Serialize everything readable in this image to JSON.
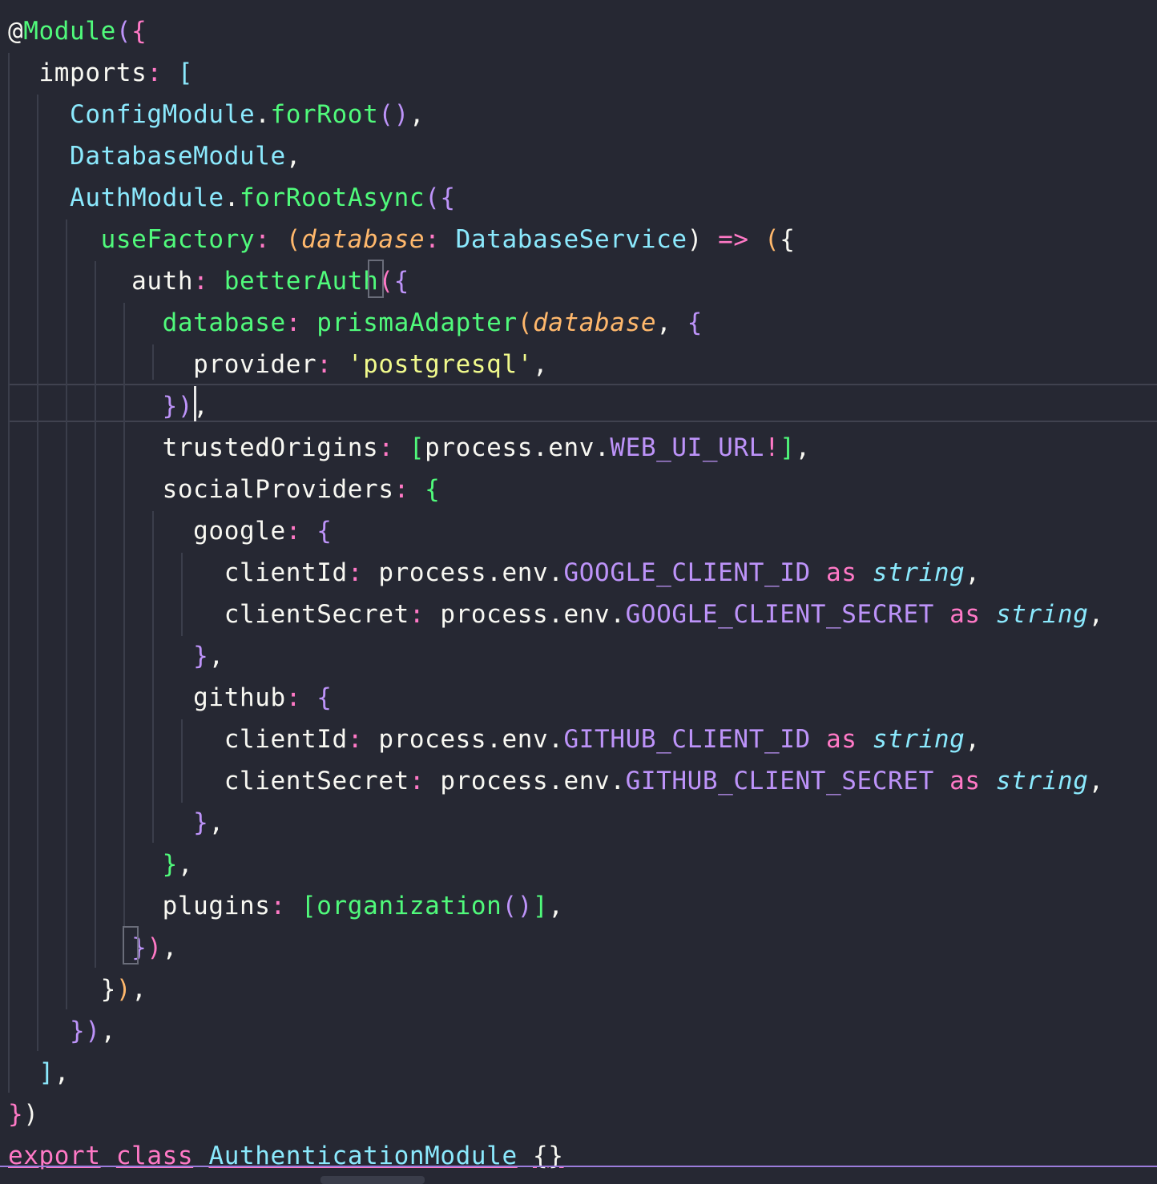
{
  "editor": {
    "language": "typescript",
    "cursor_line": 10,
    "lines": [
      [
        [
          "@",
          "white"
        ],
        [
          "Module",
          "green"
        ],
        [
          "(",
          "purple"
        ],
        [
          "{",
          "pink"
        ]
      ],
      [
        [
          "  imports",
          "white"
        ],
        [
          ":",
          "pink"
        ],
        [
          " ",
          "white"
        ],
        [
          "[",
          "cyan"
        ]
      ],
      [
        [
          "    ConfigModule",
          "cyan"
        ],
        [
          ".",
          "white"
        ],
        [
          "forRoot",
          "green"
        ],
        [
          "()",
          "purple"
        ],
        [
          ",",
          "white"
        ]
      ],
      [
        [
          "    DatabaseModule",
          "cyan"
        ],
        [
          ",",
          "white"
        ]
      ],
      [
        [
          "    AuthModule",
          "cyan"
        ],
        [
          ".",
          "white"
        ],
        [
          "forRootAsync",
          "green"
        ],
        [
          "(",
          "purple"
        ],
        [
          "{",
          "purple"
        ]
      ],
      [
        [
          "      useFactory",
          "green"
        ],
        [
          ":",
          "pink"
        ],
        [
          " ",
          "white"
        ],
        [
          "(",
          "orange"
        ],
        [
          "database",
          "orange-it"
        ],
        [
          ":",
          "pink"
        ],
        [
          " ",
          "white"
        ],
        [
          "DatabaseService",
          "cyan"
        ],
        [
          ")",
          "white"
        ],
        [
          " ",
          "white"
        ],
        [
          "=>",
          "pink"
        ],
        [
          " ",
          "white"
        ],
        [
          "(",
          "orange"
        ],
        [
          "{",
          "white"
        ]
      ],
      [
        [
          "        auth",
          "white"
        ],
        [
          ":",
          "pink"
        ],
        [
          " ",
          "white"
        ],
        [
          "betterAuth",
          "green"
        ],
        [
          "(",
          "pink"
        ],
        [
          "{",
          "purple"
        ]
      ],
      [
        [
          "          database",
          "green"
        ],
        [
          ":",
          "pink"
        ],
        [
          " ",
          "white"
        ],
        [
          "prismaAdapter",
          "green"
        ],
        [
          "(",
          "orange"
        ],
        [
          "database",
          "orange-it"
        ],
        [
          ",",
          "white"
        ],
        [
          " ",
          "white"
        ],
        [
          "{",
          "purple"
        ]
      ],
      [
        [
          "            provider",
          "white"
        ],
        [
          ":",
          "pink"
        ],
        [
          " ",
          "white"
        ],
        [
          "'postgresql'",
          "yellow"
        ],
        [
          ",",
          "white"
        ]
      ],
      [
        [
          "          }",
          "purple"
        ],
        [
          ")",
          "purple"
        ],
        [
          ",",
          "white"
        ]
      ],
      [
        [
          "          trustedOrigins",
          "white"
        ],
        [
          ":",
          "pink"
        ],
        [
          " ",
          "white"
        ],
        [
          "[",
          "green"
        ],
        [
          "process",
          "white"
        ],
        [
          ".",
          "white"
        ],
        [
          "env",
          "white"
        ],
        [
          ".",
          "white"
        ],
        [
          "WEB_UI_URL",
          "purple"
        ],
        [
          "!",
          "pink"
        ],
        [
          "]",
          "green"
        ],
        [
          ",",
          "white"
        ]
      ],
      [
        [
          "          socialProviders",
          "white"
        ],
        [
          ":",
          "pink"
        ],
        [
          " ",
          "white"
        ],
        [
          "{",
          "green"
        ]
      ],
      [
        [
          "            google",
          "white"
        ],
        [
          ":",
          "pink"
        ],
        [
          " ",
          "white"
        ],
        [
          "{",
          "purple"
        ]
      ],
      [
        [
          "              clientId",
          "white"
        ],
        [
          ":",
          "pink"
        ],
        [
          " ",
          "white"
        ],
        [
          "process",
          "white"
        ],
        [
          ".",
          "white"
        ],
        [
          "env",
          "white"
        ],
        [
          ".",
          "white"
        ],
        [
          "GOOGLE_CLIENT_ID",
          "purple"
        ],
        [
          " ",
          "white"
        ],
        [
          "as",
          "pink"
        ],
        [
          " ",
          "white"
        ],
        [
          "string",
          "cyan-it"
        ],
        [
          ",",
          "white"
        ]
      ],
      [
        [
          "              clientSecret",
          "white"
        ],
        [
          ":",
          "pink"
        ],
        [
          " ",
          "white"
        ],
        [
          "process",
          "white"
        ],
        [
          ".",
          "white"
        ],
        [
          "env",
          "white"
        ],
        [
          ".",
          "white"
        ],
        [
          "GOOGLE_CLIENT_SECRET",
          "purple"
        ],
        [
          " ",
          "white"
        ],
        [
          "as",
          "pink"
        ],
        [
          " ",
          "white"
        ],
        [
          "string",
          "cyan-it"
        ],
        [
          ",",
          "white"
        ]
      ],
      [
        [
          "            }",
          "purple"
        ],
        [
          ",",
          "white"
        ]
      ],
      [
        [
          "            github",
          "white"
        ],
        [
          ":",
          "pink"
        ],
        [
          " ",
          "white"
        ],
        [
          "{",
          "purple"
        ]
      ],
      [
        [
          "              clientId",
          "white"
        ],
        [
          ":",
          "pink"
        ],
        [
          " ",
          "white"
        ],
        [
          "process",
          "white"
        ],
        [
          ".",
          "white"
        ],
        [
          "env",
          "white"
        ],
        [
          ".",
          "white"
        ],
        [
          "GITHUB_CLIENT_ID",
          "purple"
        ],
        [
          " ",
          "white"
        ],
        [
          "as",
          "pink"
        ],
        [
          " ",
          "white"
        ],
        [
          "string",
          "cyan-it"
        ],
        [
          ",",
          "white"
        ]
      ],
      [
        [
          "              clientSecret",
          "white"
        ],
        [
          ":",
          "pink"
        ],
        [
          " ",
          "white"
        ],
        [
          "process",
          "white"
        ],
        [
          ".",
          "white"
        ],
        [
          "env",
          "white"
        ],
        [
          ".",
          "white"
        ],
        [
          "GITHUB_CLIENT_SECRET",
          "purple"
        ],
        [
          " ",
          "white"
        ],
        [
          "as",
          "pink"
        ],
        [
          " ",
          "white"
        ],
        [
          "string",
          "cyan-it"
        ],
        [
          ",",
          "white"
        ]
      ],
      [
        [
          "            }",
          "purple"
        ],
        [
          ",",
          "white"
        ]
      ],
      [
        [
          "          }",
          "green"
        ],
        [
          ",",
          "white"
        ]
      ],
      [
        [
          "          plugins",
          "white"
        ],
        [
          ":",
          "pink"
        ],
        [
          " ",
          "white"
        ],
        [
          "[",
          "green"
        ],
        [
          "organization",
          "green"
        ],
        [
          "()",
          "purple"
        ],
        [
          "]",
          "green"
        ],
        [
          ",",
          "white"
        ]
      ],
      [
        [
          "        }",
          "purple"
        ],
        [
          ")",
          "pink"
        ],
        [
          ",",
          "white"
        ]
      ],
      [
        [
          "      }",
          "white"
        ],
        [
          ")",
          "orange"
        ],
        [
          ",",
          "white"
        ]
      ],
      [
        [
          "    }",
          "purple"
        ],
        [
          ")",
          "purple"
        ],
        [
          ",",
          "white"
        ]
      ],
      [
        [
          "  ]",
          "cyan"
        ],
        [
          ",",
          "white"
        ]
      ],
      [
        [
          "}",
          "pink"
        ],
        [
          ")",
          "white"
        ]
      ],
      [
        [
          "export",
          "pink-u"
        ],
        [
          " ",
          "white"
        ],
        [
          "class",
          "pink-u"
        ],
        [
          " ",
          "white"
        ],
        [
          "AuthenticationModule",
          "cyan-u"
        ],
        [
          " ",
          "white"
        ],
        [
          "{}",
          "white-u"
        ]
      ]
    ]
  }
}
